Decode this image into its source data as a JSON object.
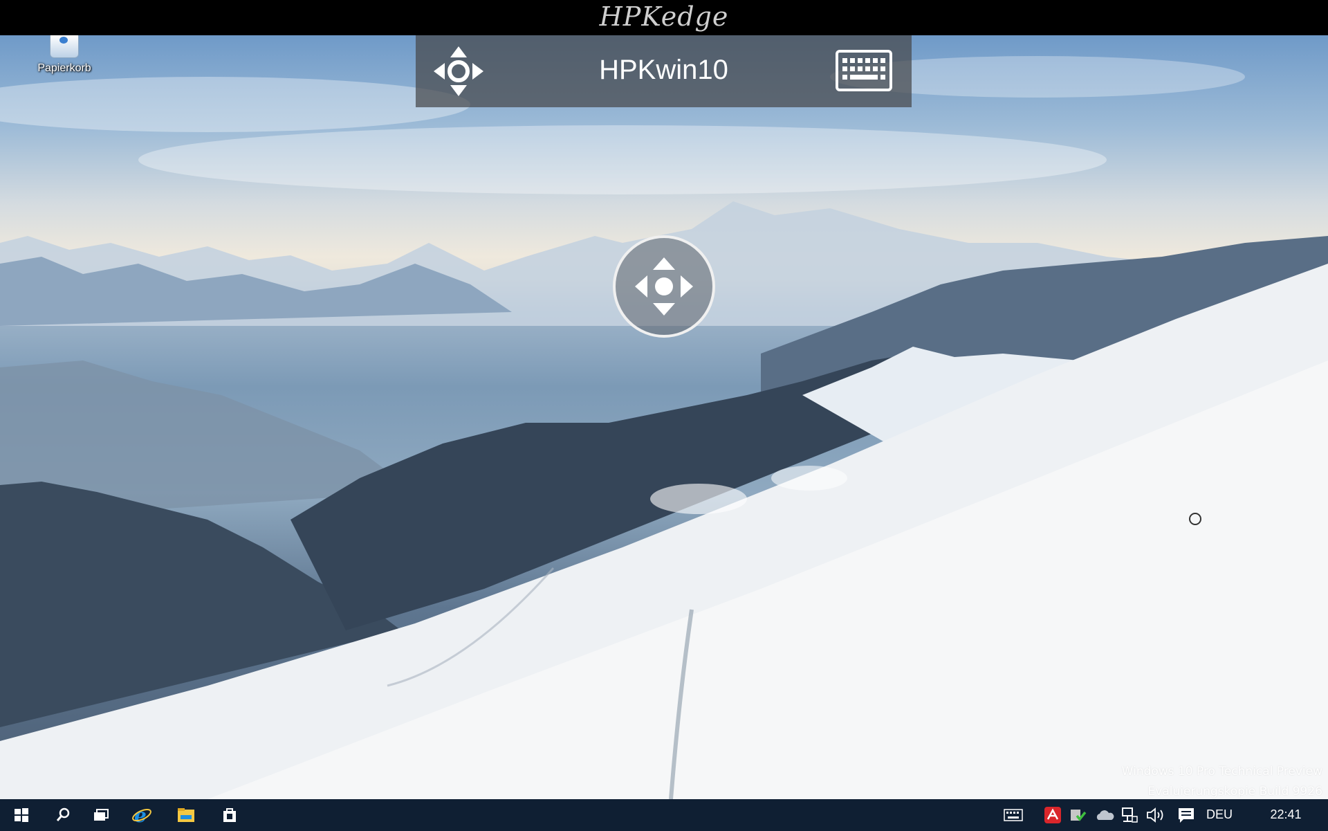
{
  "app": {
    "brand": "HPKedge"
  },
  "remote_toolbar": {
    "title": "HPKwin10",
    "pan_icon": "move-arrows-icon",
    "keyboard_icon": "keyboard-icon"
  },
  "center_control": {
    "icon": "move-arrows-icon"
  },
  "desktop": {
    "icons": [
      {
        "label": "Papierkorb",
        "icon": "recycle-bin-icon"
      }
    ],
    "watermark": {
      "line1": "Windows 10 Pro Technical Preview",
      "line2": "Evaluierungskopie Build 9926"
    }
  },
  "taskbar": {
    "pinned": [
      "start-icon",
      "search-icon",
      "task-view-icon",
      "internet-explorer-icon",
      "file-explorer-icon",
      "store-icon"
    ],
    "tray": [
      "touch-keyboard-icon",
      "antivirus-icon",
      "security-shield-icon",
      "onedrive-icon",
      "network-icon",
      "volume-icon",
      "action-center-icon"
    ],
    "language": "DEU",
    "time": "22:41"
  },
  "colors": {
    "taskbar": "#0f1f33",
    "toolbar": "#46484b",
    "ie_blue": "#1e8fe0",
    "explorer_yellow": "#f4c842",
    "antivirus_red": "#d9262b"
  }
}
